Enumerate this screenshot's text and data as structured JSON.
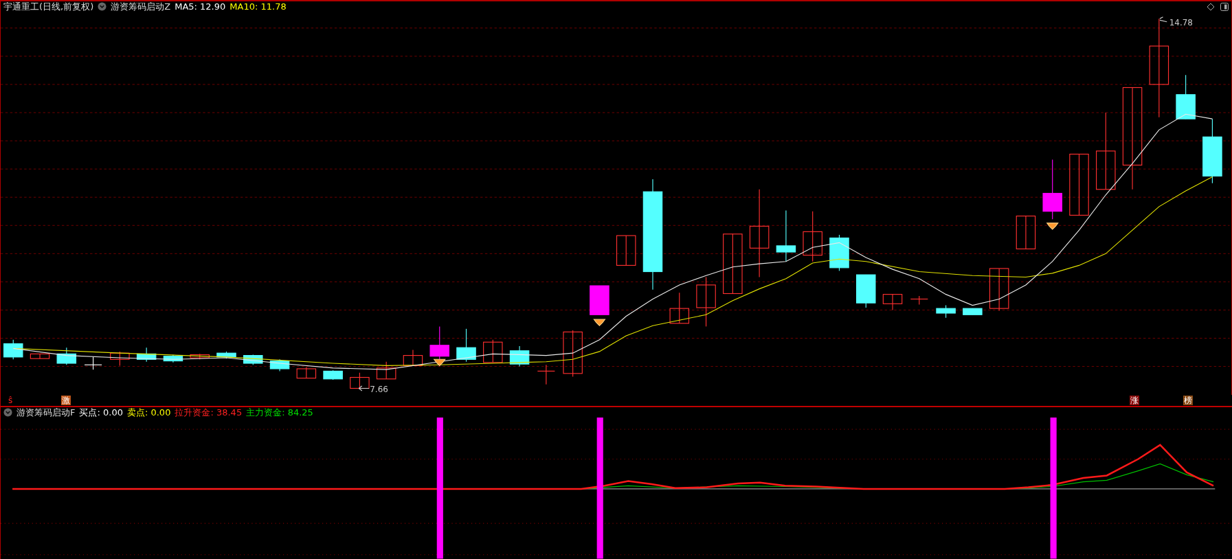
{
  "header": {
    "title": "宇通重工(日线,前复权)",
    "indicator": "游资筹码启动Z",
    "legend": [
      {
        "text": "MA5: 12.90",
        "color": "#ffffff"
      },
      {
        "text": "MA10: 11.78",
        "color": "#ffff00"
      }
    ]
  },
  "main_chart": {
    "high_label": "14.78",
    "low_label": "7.66"
  },
  "markers": [
    {
      "text": "ŝ",
      "kind": "plain",
      "color": "#ff2020"
    },
    {
      "text": "激",
      "kind": "badge",
      "color": "#c0561a"
    },
    {
      "text": "涨",
      "kind": "badge",
      "color": "#8b0c0c"
    },
    {
      "text": "榜",
      "kind": "badge",
      "color": "#8a4a14"
    }
  ],
  "sub_header": {
    "title": "游资筹码启动F",
    "legend": [
      {
        "text": "买点: 0.00",
        "color": "#ffffff"
      },
      {
        "text": "卖点: 0.00",
        "color": "#ffff00"
      },
      {
        "text": "拉升资金: 38.45",
        "color": "#ff2020"
      },
      {
        "text": "主力资金: 84.25",
        "color": "#00e000"
      }
    ]
  }
}
